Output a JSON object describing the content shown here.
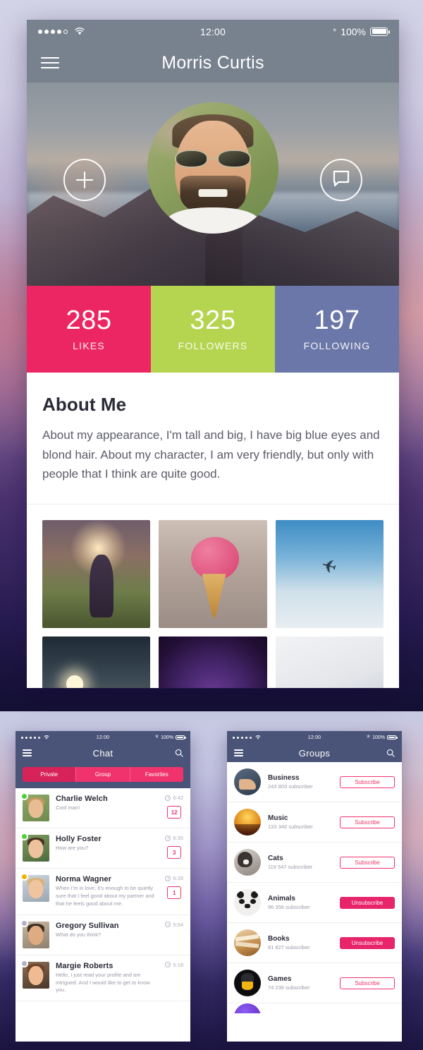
{
  "background": {
    "accent_pink": "#ec2663",
    "accent_green": "#b5d44f",
    "accent_blue": "#6b77a8",
    "nav_slate": "#78828f",
    "nav_navy": "#4a5478"
  },
  "profile_screen": {
    "statusbar": {
      "signal_icon": "signal-dots-icon",
      "wifi_icon": "wifi-icon",
      "time": "12:00",
      "bluetooth_icon": "bluetooth-icon",
      "battery_percent": "100%",
      "battery_icon": "battery-full-icon"
    },
    "nav": {
      "menu_icon": "hamburger-menu-icon",
      "title": "Morris Curtis"
    },
    "cover": {
      "avatar_name": "profile-avatar",
      "add_button_icon": "plus-icon",
      "message_button_icon": "chat-bubble-icon"
    },
    "stats": [
      {
        "number": "285",
        "label": "LIKES",
        "color": "#ec2663"
      },
      {
        "number": "325",
        "label": "FOLLOWERS",
        "color": "#b5d44f"
      },
      {
        "number": "197",
        "label": "FOLLOWING",
        "color": "#6b77a8"
      }
    ],
    "about": {
      "heading": "About Me",
      "body": "About my appearance, I'm tall and big, I have big blue eyes and blond hair. About my character, I am very friendly, but only with people that I think are quite good."
    },
    "gallery": [
      {
        "name": "photo-girl-sunset"
      },
      {
        "name": "photo-ice-cream"
      },
      {
        "name": "photo-airplane-sky"
      },
      {
        "name": "photo-street-lights"
      },
      {
        "name": "photo-night-sky"
      },
      {
        "name": "photo-keyboard-hands"
      }
    ]
  },
  "chat_screen": {
    "statusbar": {
      "signal_icon": "signal-dots-icon",
      "wifi_icon": "wifi-icon",
      "time": "12:00",
      "bluetooth_icon": "bluetooth-icon",
      "battery_percent": "100%",
      "battery_icon": "battery-full-icon"
    },
    "nav": {
      "menu_icon": "hamburger-menu-icon",
      "title": "Chat",
      "search_icon": "search-icon"
    },
    "tabs": [
      {
        "label": "Private",
        "active": true
      },
      {
        "label": "Group",
        "active": false
      },
      {
        "label": "Favorites",
        "active": false
      }
    ],
    "conversations": [
      {
        "name": "Charlie Welch",
        "message": "Cool man!",
        "time": "6:42",
        "badge": "12",
        "status": "online",
        "status_color": "#4cd137"
      },
      {
        "name": "Holly Foster",
        "message": "How are you?",
        "time": "6:35",
        "badge": "3",
        "status": "online",
        "status_color": "#4cd137"
      },
      {
        "name": "Norma Wagner",
        "message": "When I'm in love, it's enough to be quietly sure that I feel good about my partner and that he feels good about me.",
        "time": "6:28",
        "badge": "1",
        "status": "away",
        "status_color": "#f5b301"
      },
      {
        "name": "Gregory Sullivan",
        "message": "What do you think?",
        "time": "5:54",
        "badge": "",
        "status": "offline",
        "status_color": "#b0b2c6"
      },
      {
        "name": "Margie Roberts",
        "message": "Hello, I just read your profile and am intrigued. And I would like to get to know you.",
        "time": "5:18",
        "badge": "",
        "status": "offline",
        "status_color": "#b0b2c6"
      }
    ]
  },
  "groups_screen": {
    "statusbar": {
      "signal_icon": "signal-dots-icon",
      "wifi_icon": "wifi-icon",
      "time": "12:00",
      "bluetooth_icon": "bluetooth-icon",
      "battery_percent": "100%",
      "battery_icon": "battery-full-icon"
    },
    "nav": {
      "menu_icon": "hamburger-menu-icon",
      "title": "Groups",
      "search_icon": "search-icon"
    },
    "groups": [
      {
        "name": "Business",
        "subscribers": "243 803 subscriber",
        "action": "Subscribe",
        "subscribed": false
      },
      {
        "name": "Music",
        "subscribers": "133 346 subscriber",
        "action": "Subscribe",
        "subscribed": false
      },
      {
        "name": "Cats",
        "subscribers": "119 547 subscriber",
        "action": "Subscribe",
        "subscribed": false
      },
      {
        "name": "Animals",
        "subscribers": "96 356 subscriber",
        "action": "Unsubscribe",
        "subscribed": true
      },
      {
        "name": "Books",
        "subscribers": "81 827 subscriber",
        "action": "Unsubscribe",
        "subscribed": true
      },
      {
        "name": "Games",
        "subscribers": "74 236 subscriber",
        "action": "Subscribe",
        "subscribed": false
      }
    ]
  }
}
